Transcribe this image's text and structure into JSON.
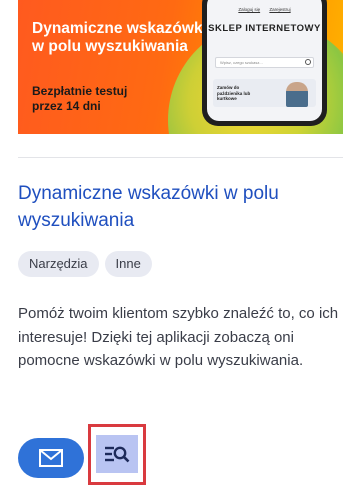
{
  "banner": {
    "headline": "Dynamiczne wskazówki w polu wyszukiwania",
    "trial": "Bezpłatnie testuj przez 14 dni",
    "phone": {
      "links": [
        "Zaloguj się",
        "Zarejestruj"
      ],
      "store_name": "SKLEP INTERNETOWY",
      "search_placeholder": "Wpisz, czego szukasz...",
      "promo_text": "Zamów do paździenika lub kurtkowe"
    }
  },
  "app": {
    "title": "Dynamiczne wskazówki w polu wyszukiwania",
    "tags": [
      "Narzędzia",
      "Inne"
    ],
    "description": "Pomóż twoim klientom szybko znaleźć to, co ich interesuje! Dzięki tej aplikacji zobaczą oni pomocne wskazówki w polu wyszukiwania."
  },
  "colors": {
    "title": "#1f4fbf",
    "mail_button": "#2f72d8",
    "preview_button": "#b9c4f2",
    "highlight_border": "#d93a3f"
  },
  "icons": {
    "mail_button": "envelope-icon",
    "preview_button": "list-search-icon"
  }
}
